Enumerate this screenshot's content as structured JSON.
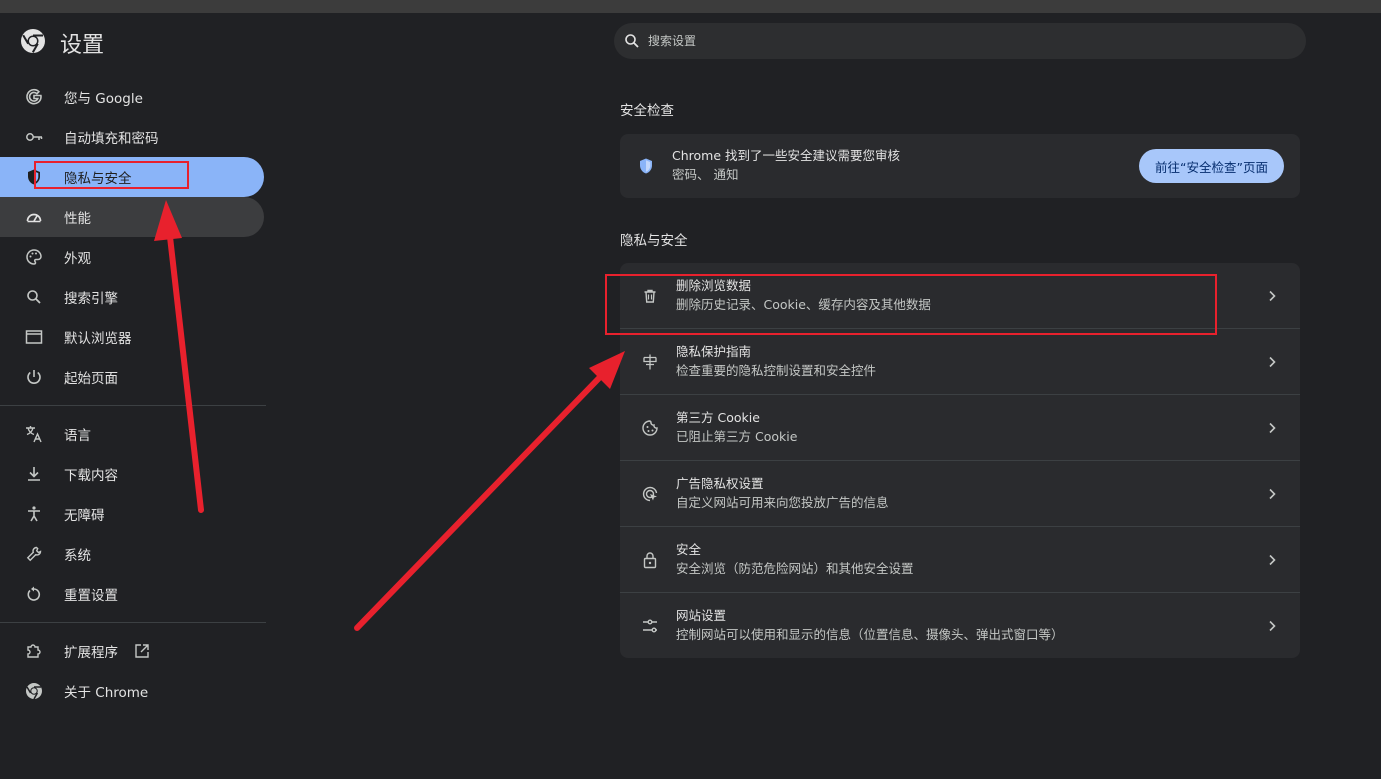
{
  "app": {
    "title": "设置",
    "logo_icon": "chrome-logo-icon"
  },
  "search": {
    "placeholder": "搜索设置",
    "icon": "search-icon"
  },
  "sidebar": {
    "items": [
      {
        "label": "您与 Google",
        "icon": "google-g-icon"
      },
      {
        "label": "自动填充和密码",
        "icon": "key-icon"
      },
      {
        "label": "隐私与安全",
        "icon": "shield-icon",
        "state": "selected"
      },
      {
        "label": "性能",
        "icon": "speedometer-icon",
        "state": "hover"
      },
      {
        "label": "外观",
        "icon": "palette-icon"
      },
      {
        "label": "搜索引擎",
        "icon": "search-icon"
      },
      {
        "label": "默认浏览器",
        "icon": "browser-window-icon"
      },
      {
        "label": "起始页面",
        "icon": "power-icon"
      }
    ],
    "items2": [
      {
        "label": "语言",
        "icon": "translate-icon"
      },
      {
        "label": "下载内容",
        "icon": "download-icon"
      },
      {
        "label": "无障碍",
        "icon": "accessibility-icon"
      },
      {
        "label": "系统",
        "icon": "wrench-icon"
      },
      {
        "label": "重置设置",
        "icon": "reset-icon"
      }
    ],
    "items3": [
      {
        "label": "扩展程序",
        "icon": "puzzle-icon",
        "trailing_icon": "open-in-new-icon"
      },
      {
        "label": "关于 Chrome",
        "icon": "chrome-logo-icon"
      }
    ]
  },
  "safety_check": {
    "section_title": "安全检查",
    "title": "Chrome 找到了一些安全建议需要您审核",
    "subtitle": "密码、 通知",
    "button": "前往“安全检查”页面",
    "icon": "shield-check-icon"
  },
  "privacy": {
    "section_title": "隐私与安全",
    "rows": [
      {
        "title": "删除浏览数据",
        "subtitle": "删除历史记录、Cookie、缓存内容及其他数据",
        "icon": "trash-icon"
      },
      {
        "title": "隐私保护指南",
        "subtitle": "检查重要的隐私控制设置和安全控件",
        "icon": "privacy-guide-icon"
      },
      {
        "title": "第三方 Cookie",
        "subtitle": "已阻止第三方 Cookie",
        "icon": "cookie-icon"
      },
      {
        "title": "广告隐私权设置",
        "subtitle": "自定义网站可用来向您投放广告的信息",
        "icon": "ad-privacy-icon"
      },
      {
        "title": "安全",
        "subtitle": "安全浏览（防范危险网站）和其他安全设置",
        "icon": "lock-icon"
      },
      {
        "title": "网站设置",
        "subtitle": "控制网站可以使用和显示的信息（位置信息、摄像头、弹出式窗口等）",
        "icon": "tune-icon"
      }
    ]
  },
  "annotations": {
    "color": "#e8212d"
  },
  "colors": {
    "background": "#202124",
    "accent": "#8ab4f8",
    "button": "#a8c7fa"
  }
}
